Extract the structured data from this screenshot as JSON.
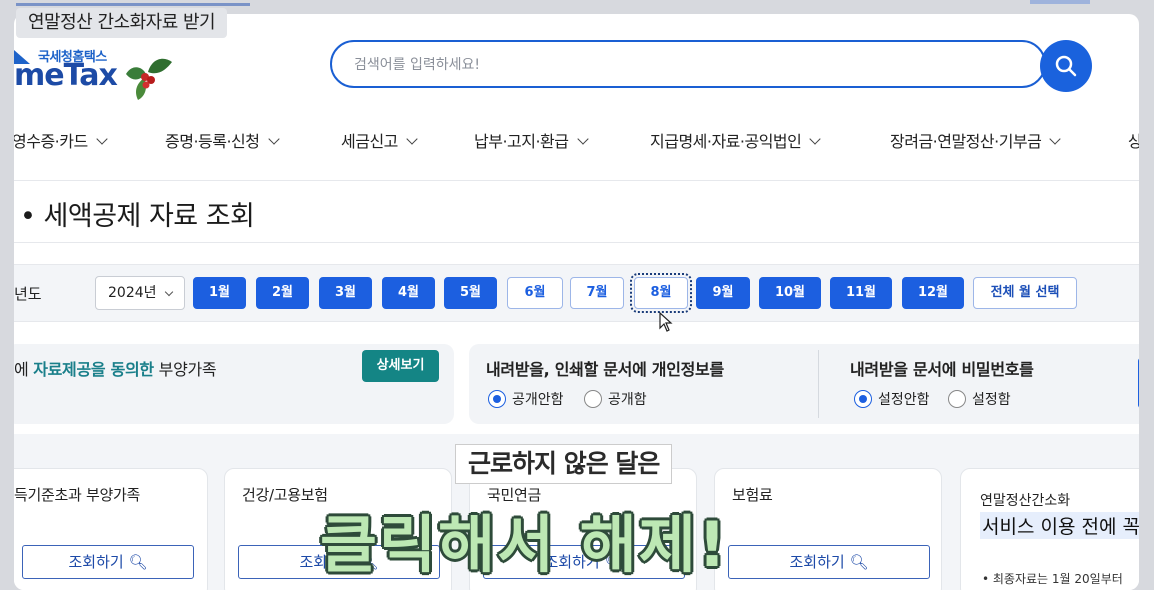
{
  "video": {
    "caption": "연말정산 간소화자료 받기"
  },
  "header": {
    "logo_small": "국세청홈택스",
    "logo_main": "meTax",
    "search_placeholder": "검색어를 입력하세요!"
  },
  "nav": {
    "items": [
      {
        "label": "영수증·카드"
      },
      {
        "label": "증명·등록·신청"
      },
      {
        "label": "세금신고"
      },
      {
        "label": "납부·고지·환급"
      },
      {
        "label": "지급명세·자료·공익법인"
      },
      {
        "label": "장려금·연말정산·기부금"
      },
      {
        "label": "상담"
      }
    ]
  },
  "page": {
    "title": "• 세액공제 자료 조회"
  },
  "months": {
    "year_label": "년도",
    "year_value": "2024년",
    "items": [
      {
        "label": "1월",
        "selected": true
      },
      {
        "label": "2월",
        "selected": true
      },
      {
        "label": "3월",
        "selected": true
      },
      {
        "label": "4월",
        "selected": true
      },
      {
        "label": "5월",
        "selected": true
      },
      {
        "label": "6월",
        "selected": false
      },
      {
        "label": "7월",
        "selected": false
      },
      {
        "label": "8월",
        "selected": false
      },
      {
        "label": "9월",
        "selected": true
      },
      {
        "label": "10월",
        "selected": true
      },
      {
        "label": "11월",
        "selected": true
      },
      {
        "label": "12월",
        "selected": true
      }
    ],
    "all_label": "전체 월 선택"
  },
  "consent": {
    "prefix": "에 ",
    "highlight": "자료제공을 동의한",
    "suffix": " 부양가족",
    "detail_label": "상세보기"
  },
  "privacy": {
    "title": "내려받을, 인쇄할 문서에 개인정보를",
    "options": [
      "공개안함",
      "공개함"
    ]
  },
  "password": {
    "title": "내려받을 문서에 비밀번호를",
    "options": [
      "설정안함",
      "설정함"
    ]
  },
  "cards": [
    {
      "title": "득기준초과 부양가족",
      "query": "조회하기"
    },
    {
      "title": "건강/고용보험",
      "query": "조회하기"
    },
    {
      "title": "국민연금",
      "query": "조회하기"
    },
    {
      "title": "보험료",
      "query": "조회하기"
    }
  ],
  "notice_card": {
    "label": "연말정산간소화",
    "heading": "서비스 이용 전에 꼭",
    "note": "• 최종자료는 1월 20일부터"
  },
  "subtitles": {
    "line1": "근로하지 않은 달은",
    "line2": "클릭해서 해제!"
  },
  "colors": {
    "accent": "#1c5fe0",
    "teal": "#148585"
  }
}
